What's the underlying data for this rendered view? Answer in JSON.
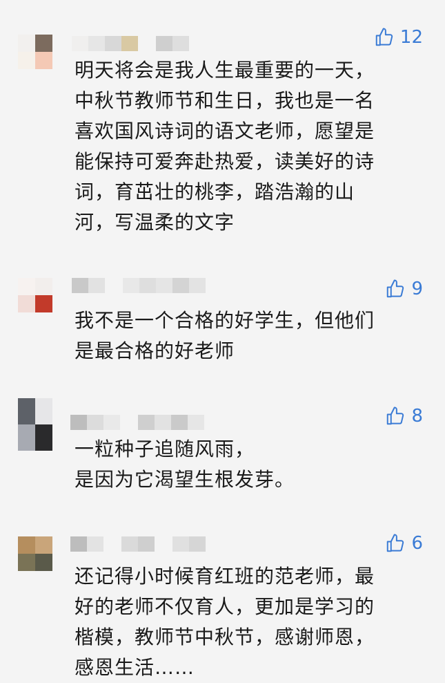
{
  "comments": [
    {
      "likes": "12",
      "text": "明天将会是我人生最重要的一天，\n中秋节教师节和生日，我也是一名\n喜欢国风诗词的语文老师，愿望是\n能保持可爱奔赴热爱，读美好的诗\n词，育茁壮的桃李，踏浩瀚的山\n河，写温柔的文字"
    },
    {
      "likes": "9",
      "text": "我不是一个合格的好学生，但他们\n是最合格的好老师"
    },
    {
      "likes": "8",
      "text": "一粒种子追随风雨，\n是因为它渴望生根发芽。"
    },
    {
      "likes": "6",
      "text": "还记得小时候育红班的范老师，最\n好的老师不仅育人，更加是学习的\n楷模，教师节中秋节，感谢师恩，\n感恩生活……"
    }
  ],
  "colors": {
    "accent": "#3a7bd5",
    "background": "#f4f4f4",
    "text": "#1a1a1a"
  },
  "icons": {
    "like": "thumbs-up-icon"
  }
}
